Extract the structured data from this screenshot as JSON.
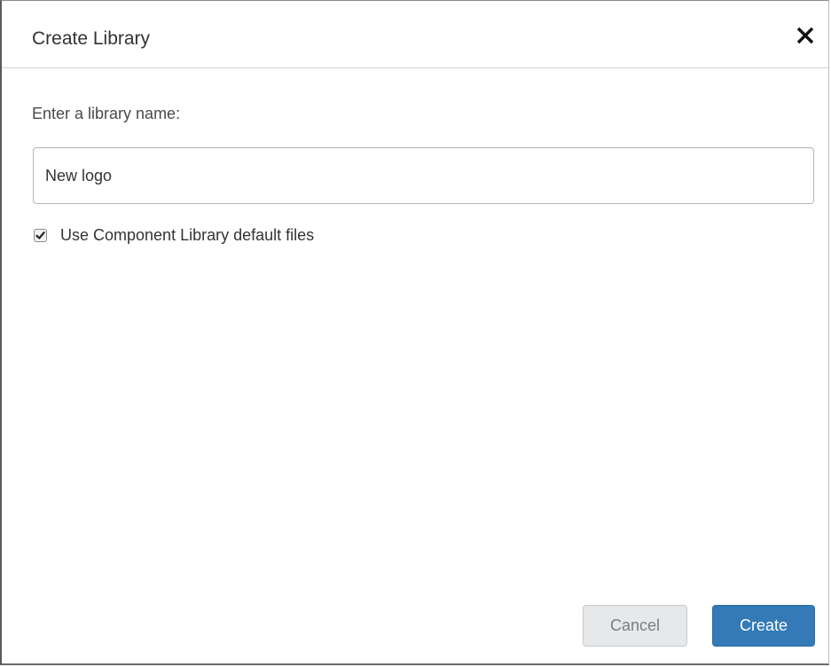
{
  "dialog": {
    "title": "Create Library",
    "close_icon": "close-icon",
    "prompt_label": "Enter a library name:",
    "name_input": {
      "value": "New logo",
      "placeholder": ""
    },
    "default_files_checkbox": {
      "label": "Use Component Library default files",
      "checked": true
    },
    "buttons": {
      "cancel_label": "Cancel",
      "create_label": "Create"
    }
  },
  "colors": {
    "primary": "#337ab7",
    "cancel_bg": "#e6e8ea",
    "header_divider": "#c9d3dc"
  }
}
